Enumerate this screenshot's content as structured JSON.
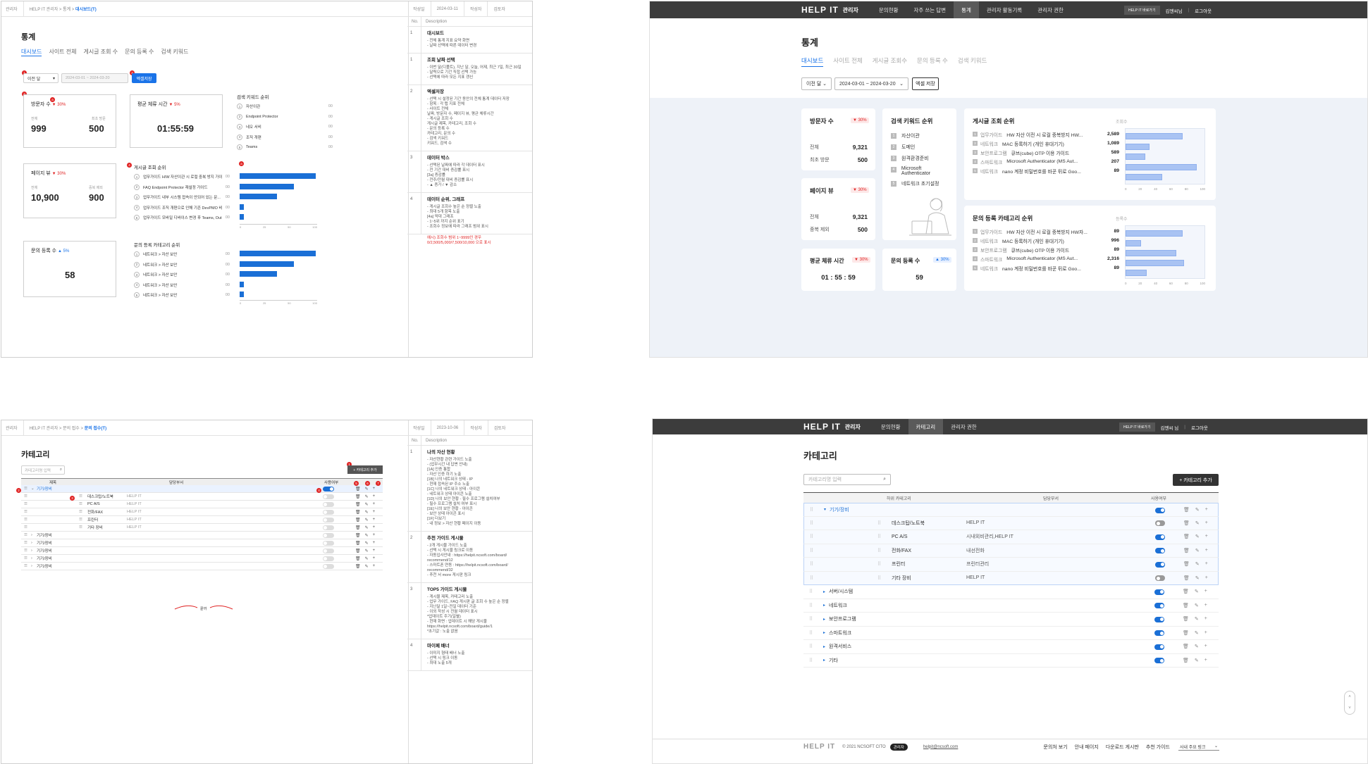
{
  "spec_stats": {
    "top": {
      "crumb_a": "관리자",
      "crumb_b": "HELP IT 관리자 > 통계 >",
      "crumb_cur": "대시보드(T)",
      "author": "작성일",
      "date": "2024-03-11",
      "editor": "작성자",
      "reviewer": "검토자"
    },
    "side_head": {
      "no": "No.",
      "desc": "Description"
    },
    "title": "통계",
    "tabs": [
      "대시보드",
      "사이트 전체",
      "게시글 조회 수",
      "문의 등록 수",
      "검색 키워드"
    ],
    "period_select": "이전 달",
    "date_range": "2024-03-01 ~ 2024-03-20",
    "excel_btn": "엑셀저장",
    "visitors": {
      "title": "방문자 수",
      "pct": "▼ 30%",
      "l1": "전체",
      "l2": "최초 방문",
      "v1": "999",
      "v2": "500"
    },
    "avg_time": {
      "title": "평균 체류 시간",
      "pct": "▼ 5%",
      "value": "01:55:59"
    },
    "pageview": {
      "title": "페이지 뷰",
      "pct": "▼ 30%",
      "l1": "전체",
      "l2": "중복 제외",
      "v1": "10,900",
      "v2": "900"
    },
    "inquiry": {
      "title": "문의 등록 수",
      "pct": "▲ 5%",
      "value": "58"
    },
    "keyword_title": "검색 키워드 순위",
    "keywords": [
      "자산이관",
      "Endpoint Protector",
      "네오 서비",
      "조직 개편",
      "Teams"
    ],
    "keyword_vals": [
      "00",
      "00",
      "00",
      "00",
      "00"
    ],
    "post_rank_title": "게시글 조회 순위",
    "posts": [
      "업무가이드 H/W 자산이관 시 로컬 중복 방지 가이드",
      "FAQ Endpoint Protector 재설정 가이드",
      "업무가이드 내부 시스템 접속이 안되어 있는 문...",
      "업무가이드 조직 개편으로 인해 기존 DevPMO 비...",
      "업무가이드 모바일 디바이스 변경 후 Teams, Outlo..."
    ],
    "post_vals": [
      "00",
      "00",
      "00",
      "00",
      "00"
    ],
    "cat_rank_title": "문의 등록 카테고리 순위",
    "cats": [
      "네트워크 > 자산 보안",
      "네트워크 > 자산 보안",
      "네트워크 > 자산 보안",
      "네트워크 > 자산 보안",
      "네트워크 > 자산 보안"
    ],
    "cat_vals": [
      "00",
      "00",
      "00",
      "00",
      "00"
    ],
    "axis": [
      "0",
      "25",
      "50",
      "100"
    ],
    "desc": [
      {
        "no": "1",
        "title": "대시보드",
        "lines": [
          "- 전체 통계 지표 요약 화면",
          "- 날짜 선택에 따른 데이터 변경"
        ]
      },
      {
        "no": "1",
        "title": "조회 날짜 선택",
        "lines": [
          "- 이번 달(디폴트), 지난 달, 오늘, 어제, 최근 7일, 최근 30일",
          "- 달력으로 기간 직접 선택 가능",
          "- 선택에 따라 모든 지표 갱신"
        ]
      },
      {
        "no": "2",
        "title": "엑셀저장",
        "lines": [
          "- 선택 시 설정된 기간 동안의 전체 통계 데이터 저장",
          "- 항목 : 각 탭 지표 전체",
          "- 사이트 전체",
          "  날짜, 방문자 수, 페이지 뷰, 평균 체류시간",
          "- 게시글 조회 수",
          "  게시글 제목, 카테고리, 조회 수",
          "- 문의 등록 수",
          "  카테고리, 문의 수",
          "- 검색 키워드",
          "  키워드, 검색 수"
        ]
      },
      {
        "no": "3",
        "title": "데이터 박스",
        "lines": [
          "- 선택된 날짜에 따라 각 데이터 표시",
          "- 전 기간 대비 증감률 표시",
          "[3a] 증감률",
          "- 전주/전월 대비 증감률 표시",
          "- ▲ 증가 / ▼ 감소"
        ]
      },
      {
        "no": "4",
        "title": "데이터 순위, 그래프",
        "lines": [
          "- 게시글 조회수 높은 순 정렬 노출",
          "- 최대 5개 항목 노출",
          "[4a] 막대 그래프",
          "- 1~5위 까지 순위 표기",
          "- 조회수 정보에 따라 그래프 범위 표시"
        ]
      }
    ],
    "desc_red": "예시) 조회수 범위 1~9999인 경우 0/2,500/5,000/7,500/10,000 으로 표시"
  },
  "real_stats": {
    "logo": "HELP IT",
    "logo_sub": "관리자",
    "nav": [
      "문의현황",
      "자주 쓰는 답변",
      "통계",
      "관리자 활동기록",
      "관리자 권한"
    ],
    "nav_active": "통계",
    "shortcut": "HELP IT 바로가기",
    "user": "김엔씨님",
    "logout": "로그아웃",
    "title": "통계",
    "tabs": [
      "대시보드",
      "사이트 전체",
      "게시글 조회수",
      "문의 등록 수",
      "검색 키워드"
    ],
    "period_select": "이전 달",
    "date_range": "2024-03-01 ~ 2024-03-20",
    "excel_btn": "엑셀 저장",
    "visitors": {
      "title": "방문자 수",
      "pct": "▼ 30%",
      "l1": "전체",
      "v1": "9,321",
      "l2": "최초 방문",
      "v2": "500"
    },
    "pageview": {
      "title": "페이지 뷰",
      "pct": "▼ 30%",
      "l1": "전체",
      "v1": "9,321",
      "l2": "중복 제외",
      "v2": "500"
    },
    "avg_time": {
      "title": "평균 체류 시간",
      "pct": "▼ 30%",
      "value": "01 : 55 : 59"
    },
    "inquiry": {
      "title": "문의 등록 수",
      "pct": "▲ 30%",
      "value": "59"
    },
    "kw_title": "검색 키워드 순위",
    "keywords": [
      "자산이관",
      "도메인",
      "원격환경준비",
      "Microsoft Authenticator",
      "네트워크 초기설정"
    ],
    "post_title": "게시글 조회 순위",
    "post_sub": "조회수",
    "posts": [
      {
        "cat": "업무가이드",
        "name": "HW 자산 이전 시 로컬 중복방지 HW...",
        "val": "2,589"
      },
      {
        "cat": "네트워크",
        "name": "MAC 등록하기 (개인 휴대기기)",
        "val": "1,089"
      },
      {
        "cat": "보안프로그램",
        "name": "큐브(cube) OTP 이용 가이드",
        "val": "589"
      },
      {
        "cat": "스마트워크",
        "name": "Microsoft Authenticator (MS Aut...",
        "val": "207"
      },
      {
        "cat": "네트워크",
        "name": "nano 계정 비밀번호를 바꾼 뒤로 Goo...",
        "val": "89"
      }
    ],
    "cat_title": "문의 등록 카테고리 순위",
    "cat_sub": "등록수",
    "cats": [
      {
        "cat": "업무가이드",
        "name": "HW 자산 이전 시 로컬 중복방지 HW자...",
        "val": "89"
      },
      {
        "cat": "네트워크",
        "name": "MAC 등록하기 (개인 휴대기기)",
        "val": "996"
      },
      {
        "cat": "보안프로그램",
        "name": "큐브(cube) OTP 이용 가이드",
        "val": "89"
      },
      {
        "cat": "스마트워크",
        "name": "Microsoft Authenticator (MS Aut...",
        "val": "2,316"
      },
      {
        "cat": "네트워크",
        "name": "nano 계정 비밀번호를 바꾼 뒤로 Goo...",
        "val": "89"
      }
    ],
    "post_bars": [
      0.72,
      0.3,
      0.25,
      0.9,
      0.46
    ],
    "cat_bars": [
      0.72,
      0.2,
      0.64,
      0.74,
      0.27
    ],
    "axis": [
      "0",
      "20",
      "40",
      "60",
      "80",
      "100"
    ]
  },
  "spec_cat": {
    "top": {
      "crumb_a": "관리자",
      "crumb_b": "HELP IT 관리자 > 문의 접수 >",
      "crumb_cur": "문의 접수(T)",
      "author": "작성일",
      "date": "2023-10-06",
      "editor": "작성자",
      "reviewer": "검토자"
    },
    "side_head": {
      "no": "No.",
      "desc": "Description"
    },
    "title": "카테고리",
    "search_ph": "카테고리명 입력",
    "add_btn": "+ 카테고리 추가",
    "cols": [
      "제목",
      "담당부서",
      "사용여부"
    ],
    "rows": [
      {
        "name": "기기/장비",
        "dept": "",
        "sub": false,
        "on": true,
        "open": true
      },
      {
        "name": "데스크탑/노트북",
        "dept": "HELP IT",
        "sub": true,
        "on": false
      },
      {
        "name": "PC A/S",
        "dept": "HELP IT",
        "sub": true,
        "on": false
      },
      {
        "name": "전화/FAX",
        "dept": "HELP IT",
        "sub": true,
        "on": false
      },
      {
        "name": "프린터",
        "dept": "HELP IT",
        "sub": true,
        "on": false
      },
      {
        "name": "기타 장비",
        "dept": "HELP IT",
        "sub": true,
        "on": false
      },
      {
        "name": "기기/장비",
        "dept": "",
        "sub": false,
        "on": false
      },
      {
        "name": "기기/장비",
        "dept": "",
        "sub": false,
        "on": false
      },
      {
        "name": "기기/장비",
        "dept": "",
        "sub": false,
        "on": false
      },
      {
        "name": "기기/장비",
        "dept": "",
        "sub": false,
        "on": false
      },
      {
        "name": "기기/장비",
        "dept": "",
        "sub": false,
        "on": false
      }
    ],
    "footer_note": "끝까",
    "desc": [
      {
        "no": "1",
        "title": "나의 자산 현황",
        "lines": [
          "- 자산현황 관련 가이드 노출",
          "- (업무시간 내 답변 안내)",
          "[1A] 인증 통합",
          "- 자산 인증 하기 노출",
          "[1B] 나의 네트워크 상태 - IP",
          "- 현재 접속된 IP 주소 노출",
          "[1C] 나의 네트워크 상태 - 아이콘",
          "- 네트워크 상태 아이콘 노출",
          "[1D] 나의 보안 현황 - 필수 프로그램 설치여부",
          "- 필수 프로그램 설치 여부 표시",
          "[1E] 나의 보안 현황 - 아이콘",
          "- 보안 상태 아이콘 표시",
          "[1F] 더보기",
          "- 내 정보 > 자산 현황 페이지 이동"
        ]
      },
      {
        "no": "2",
        "title": "추천 가이드 게시물",
        "lines": [
          "- 2개 게시물 가이드 노출",
          "- 선택 시 게시물 링크로 이동",
          "- 자동입사안내 : https://helpit.ncsoft.com/board/",
          "  recommend/12",
          "- 스마트폰 연동 : https://helpit.ncsoft.com/board/",
          "  recommend/32",
          "- 추천 서 more 게시판 링크"
        ]
      },
      {
        "no": "3",
        "title": "TOP5 가이드 게시물",
        "lines": [
          "- 게시물 제목, 카테고리 노출",
          "- 업무 가이드, FAQ 게시판 글 조회 수 높은 순 정렬",
          "- 지난달 1일~전일 데이터 기준",
          "- 이외 작성 시 전월 데이터 표시",
          "*업데이트 주기(일별)",
          "- 현재 화면 : 업데이트 시 해당 게시물",
          "  https://helpit.ncsoft.com/board/guide/1",
          "*초기값 : 노출 없음"
        ]
      },
      {
        "no": "4",
        "title": "마이페 배너",
        "lines": [
          "- 이미지 형태 배너 노출",
          "- 선택 시 링크 이동",
          "- 최대 노출 5개"
        ]
      }
    ]
  },
  "real_cat": {
    "logo": "HELP IT",
    "logo_sub": "관리자",
    "nav": [
      "문의현황",
      "카테고리",
      "관리자 권한"
    ],
    "nav_active": "카테고리",
    "shortcut": "HELP IT 바로가기",
    "user": "김엔씨 님",
    "logout": "로그아웃",
    "title": "카테고리",
    "search_ph": "카테고리명 입력",
    "add_btn": "+ 카테고리 추가",
    "cols": [
      "상위 카테고리",
      "하위 카테고리",
      "담당부서",
      "사용여부"
    ],
    "rows": [
      {
        "name": "기기/장비",
        "dept": "",
        "sub": false,
        "on": true,
        "open": true
      },
      {
        "name": "데스크탑/노트북",
        "dept": "HELP IT",
        "sub": true,
        "on": false
      },
      {
        "name": "PC A/S",
        "dept": "시내외비관리,HELP IT",
        "sub": true,
        "on": true
      },
      {
        "name": "전화/FAX",
        "dept": "내선전화",
        "sub": true,
        "on": true
      },
      {
        "name": "프린터",
        "dept": "프린터관리",
        "sub": true,
        "on": true
      },
      {
        "name": "기타 장비",
        "dept": "HELP IT",
        "sub": true,
        "on": false
      },
      {
        "name": "서버/시스템",
        "dept": "",
        "sub": false,
        "on": true
      },
      {
        "name": "네트워크",
        "dept": "",
        "sub": false,
        "on": true
      },
      {
        "name": "보안프로그램",
        "dept": "",
        "sub": false,
        "on": true
      },
      {
        "name": "스마트워크",
        "dept": "",
        "sub": false,
        "on": true
      },
      {
        "name": "원격서비스",
        "dept": "",
        "sub": false,
        "on": true
      },
      {
        "name": "기타",
        "dept": "",
        "sub": false,
        "on": true
      }
    ],
    "footer": {
      "logo": "HELP IT",
      "copy": "© 2021 NCSOFT CITO",
      "admin_badge": "관리자",
      "email": "helpit@ncsoft.com",
      "links": [
        "문의처 보기",
        "안내 페이지",
        "다운로드 게시판",
        "추천 가이드"
      ],
      "site_select": "사내 주요 링크"
    }
  }
}
